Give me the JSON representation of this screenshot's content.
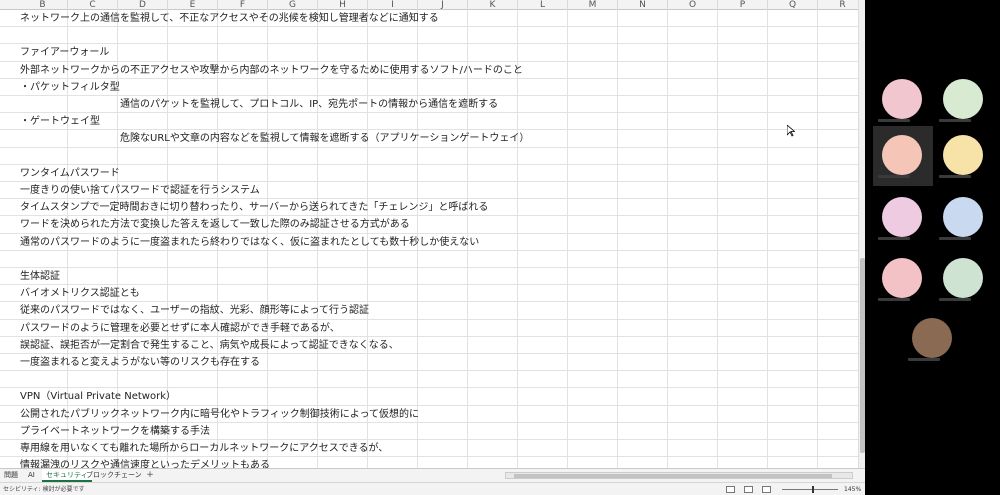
{
  "columns": [
    "B",
    "C",
    "D",
    "E",
    "F",
    "G",
    "H",
    "I",
    "J",
    "K",
    "L",
    "M",
    "N",
    "O",
    "P",
    "Q",
    "R"
  ],
  "rows": [
    {
      "text": "ネットワーク上の通信を監視して、不正なアクセスやその兆候を検知し管理者などに通知する",
      "col": "B"
    },
    {
      "text": "",
      "col": "B"
    },
    {
      "text": "ファイアーウォール",
      "col": "B"
    },
    {
      "text": "外部ネットワークからの不正アクセスや攻撃から内部のネットワークを守るために使用するソフト/ハードのこと",
      "col": "B"
    },
    {
      "text": "・パケットフィルタ型",
      "col": "B"
    },
    {
      "text": "通信のパケットを監視して、プロトコル、IP、宛先ポートの情報から通信を遮断する",
      "col": "D"
    },
    {
      "text": "・ゲートウェイ型",
      "col": "B"
    },
    {
      "text": "危険なURLや文章の内容などを監視して情報を遮断する（アプリケーションゲートウェイ）",
      "col": "D"
    },
    {
      "text": "",
      "col": "B"
    },
    {
      "text": "ワンタイムパスワード",
      "col": "B"
    },
    {
      "text": "一度きりの使い捨てパスワードで認証を行うシステム",
      "col": "B"
    },
    {
      "text": "タイムスタンプで一定時間おきに切り替わったり、サーバーから送られてきた「チェレンジ」と呼ばれる",
      "col": "B"
    },
    {
      "text": "ワードを決められた方法で変換した答えを返して一致した際のみ認証させる方式がある",
      "col": "B"
    },
    {
      "text": "通常のパスワードのように一度盗まれたら終わりではなく、仮に盗まれたとしても数十秒しか使えない",
      "col": "B"
    },
    {
      "text": "",
      "col": "B"
    },
    {
      "text": "生体認証",
      "col": "B"
    },
    {
      "text": "バイオメトリクス認証とも",
      "col": "B"
    },
    {
      "text": "従来のパスワードではなく、ユーザーの指紋、光彩、顔形等によって行う認証",
      "col": "B"
    },
    {
      "text": "パスワードのように管理を必要とせずに本人確認ができ手軽であるが、",
      "col": "B"
    },
    {
      "text": "誤認証、誤拒否が一定割合で発生すること、病気や成長によって認証できなくなる、",
      "col": "B"
    },
    {
      "text": "一度盗まれると変えようがない等のリスクも存在する",
      "col": "B"
    },
    {
      "text": "",
      "col": "B"
    },
    {
      "text": "VPN（Virtual Private Network）",
      "col": "B"
    },
    {
      "text": "公開されたパブリックネットワーク内に暗号化やトラフィック制御技術によって仮想的に",
      "col": "B"
    },
    {
      "text": "プライベートネットワークを構築する手法",
      "col": "B"
    },
    {
      "text": "専用線を用いなくても離れた場所からローカルネットワークにアクセスできるが、",
      "col": "B"
    },
    {
      "text": "情報漏洩のリスクや通信速度といったデメリットもある",
      "col": "B"
    }
  ],
  "sheet_tabs": [
    {
      "label": "問題",
      "active": false
    },
    {
      "label": "AI",
      "active": false
    },
    {
      "label": "セキュリティ",
      "active": true
    },
    {
      "label": "ブロックチェーン",
      "active": false
    }
  ],
  "add_sheet_label": "+",
  "status_text": "セシビリティ: 検討が必要です",
  "zoom_label": "145%",
  "participants": [
    {
      "color": "#f2c6cf"
    },
    {
      "color": "#d9ead3"
    },
    {
      "color": "#f5c6b8"
    },
    {
      "color": "#f7e2a8"
    },
    {
      "color": "#eecbe0"
    },
    {
      "color": "#c9d9f0"
    },
    {
      "color": "#f2c2c6"
    },
    {
      "color": "#cfe3d2"
    },
    {
      "color": "#8a6a52"
    }
  ]
}
